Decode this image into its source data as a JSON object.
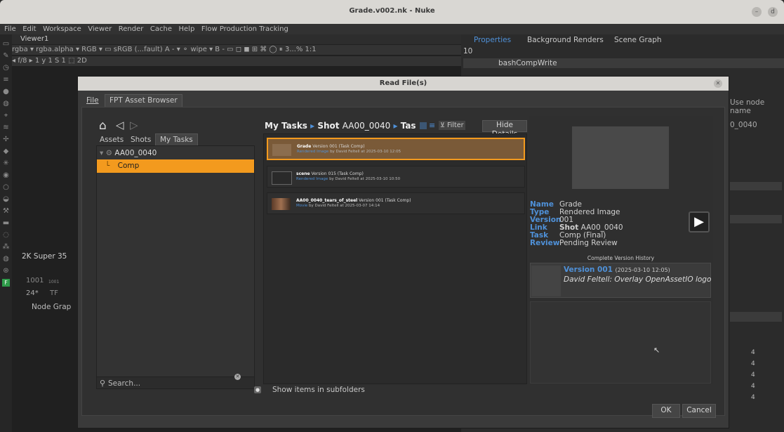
{
  "window": {
    "title": "Grade.v002.nk - Nuke"
  },
  "menu": [
    "File",
    "Edit",
    "Workspace",
    "Viewer",
    "Render",
    "Cache",
    "Help",
    "Flow Production Tracking"
  ],
  "viewer": {
    "tab": "Viewer1",
    "row1": "rgba  ▾  rgba.alpha  ▾  RGB  ▾  ▭  sRGB (...fault)  A  -     ▾   ⚬  wipe    ▾  B  -          ▭ ◻ ◼ ⊞ ⌘ ◯ ⏸  3...%  1:1",
    "row2": "◂  f/8  ▸ 1                            y  1                             S  1                                   ⬚  2D",
    "format": "2K Super 35",
    "frame_in": "1001",
    "frame_sub": "1001",
    "fps": "24*",
    "tf": "TF",
    "node_graph_tab": "Node Grap"
  },
  "properties": {
    "tabs": [
      "Properties",
      "Background Renders",
      "Scene Graph"
    ],
    "count": "10",
    "node_name": "bashCompWrite",
    "side_label": "Use node name",
    "side_value": "0_0040",
    "side_values": [
      "4",
      "4",
      "4",
      "4",
      "4"
    ]
  },
  "dialog": {
    "title": "Read File(s)",
    "menu_file": "File",
    "tab": "FPT Asset Browser",
    "nav_tabs": [
      "Assets",
      "Shots",
      "My Tasks"
    ],
    "tree_root": "AA00_0040",
    "tree_child": "Comp",
    "search_placeholder": "Search...",
    "breadcrumb_1": "My Tasks",
    "breadcrumb_2": "Shot",
    "breadcrumb_2_value": "AA00_0040",
    "breadcrumb_3": "Tas",
    "filter_label": "Filter",
    "hide_details": "Hide Details",
    "items": [
      {
        "name": "Grade",
        "meta": "Version 001 (Task Comp)",
        "type": "Rendered Image",
        "by": "by David Feltell at 2025-03-10 12:05"
      },
      {
        "name": "scene",
        "meta": "Version 015 (Task Comp)",
        "type": "Rendered Image",
        "by": "by David Feltell at 2025-03-10 10:50"
      },
      {
        "name": "AA00_0040_tears_of_steel",
        "meta": "Version 001 (Task Comp)",
        "type": "Movie",
        "by": "by David Feltell at 2025-03-07 14:14"
      }
    ],
    "show_subfolders": "Show items in subfolders",
    "details": {
      "labels": [
        "Name",
        "Type",
        "Version",
        "Link",
        "Task",
        "Review"
      ],
      "name": "Grade",
      "type": "Rendered Image",
      "version": "001",
      "link_bold": "Shot",
      "link_value": "AA00_0040",
      "task": "Comp (Final)",
      "review": "Pending Review"
    },
    "history_title": "Complete Version History",
    "history": {
      "version": "Version 001",
      "date": "(2025-03-10 12:05)",
      "author": "David Feltell",
      "note": ": Overlay OpenAssetIO logo"
    },
    "ok": "OK",
    "cancel": "Cancel"
  },
  "colors": {
    "accent_orange": "#f39a1e",
    "link_blue": "#4f91d9"
  }
}
